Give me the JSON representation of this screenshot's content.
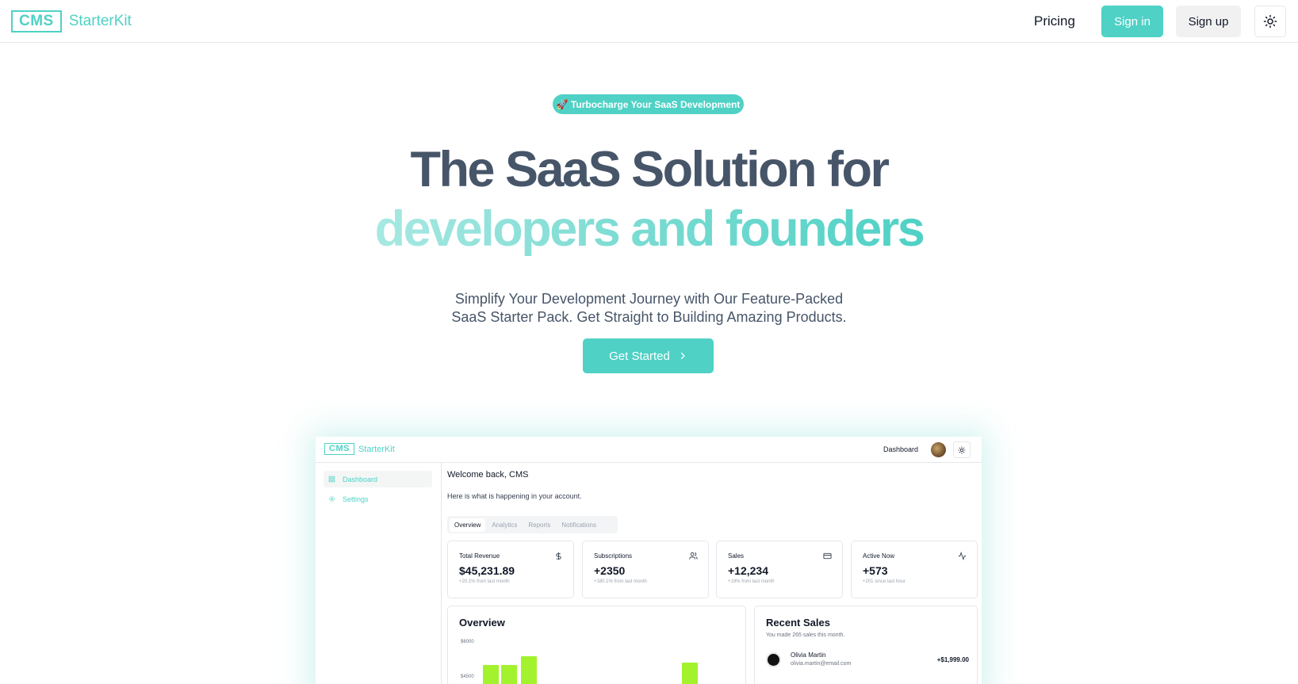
{
  "nav": {
    "logo_box": "CMS",
    "logo_text": "StarterKit",
    "pricing": "Pricing",
    "sign_in": "Sign in",
    "sign_up": "Sign up",
    "theme_icon": "sun-icon"
  },
  "hero": {
    "badge": "🚀 Turbocharge Your SaaS Development",
    "title_line1": "The SaaS Solution for",
    "title_line2": "developers and founders",
    "subtitle_line1": "Simplify Your Development Journey with Our Feature-Packed",
    "subtitle_line2": "SaaS Starter Pack. Get Straight to Building Amazing Products.",
    "cta": "Get Started"
  },
  "colors": {
    "accent": "#4fd1c5",
    "heading": "#475569",
    "bar": "#a3f22e"
  },
  "preview": {
    "logo_box": "CMS",
    "logo_text": "StarterKit",
    "header_link": "Dashboard",
    "sidebar": [
      {
        "label": "Dashboard",
        "icon": "grid-icon",
        "active": true
      },
      {
        "label": "Settings",
        "icon": "gear-icon",
        "active": false
      }
    ],
    "welcome": "Welcome back, CMS",
    "happening": "Here is what is happening in your account.",
    "tabs": [
      "Overview",
      "Analytics",
      "Reports",
      "Notifications"
    ],
    "stats": [
      {
        "label": "Total Revenue",
        "value": "$45,231.89",
        "change": "+20.1% from last month",
        "icon": "dollar-icon"
      },
      {
        "label": "Subscriptions",
        "value": "+2350",
        "change": "+180.1% from last month",
        "icon": "users-icon"
      },
      {
        "label": "Sales",
        "value": "+12,234",
        "change": "+19% from last month",
        "icon": "credit-card-icon"
      },
      {
        "label": "Active Now",
        "value": "+573",
        "change": "+201 since last hour",
        "icon": "activity-icon"
      }
    ],
    "overview": {
      "title": "Overview",
      "y_ticks": [
        "$6000",
        "$4500"
      ]
    },
    "recent_sales": {
      "title": "Recent Sales",
      "description": "You made 265 sales this month.",
      "items": [
        {
          "name": "Olivia Martin",
          "email": "olivia.martin@email.com",
          "amount": "+$1,999.00"
        }
      ]
    }
  },
  "chart_data": {
    "type": "bar",
    "title": "Overview",
    "y_ticks": [
      6000,
      4500
    ],
    "visible_bars": [
      {
        "label": "",
        "value": 5000
      },
      {
        "label": "",
        "value": 5000
      },
      {
        "label": "",
        "value": 5400
      },
      {
        "label": "",
        "value": 5100
      }
    ]
  }
}
